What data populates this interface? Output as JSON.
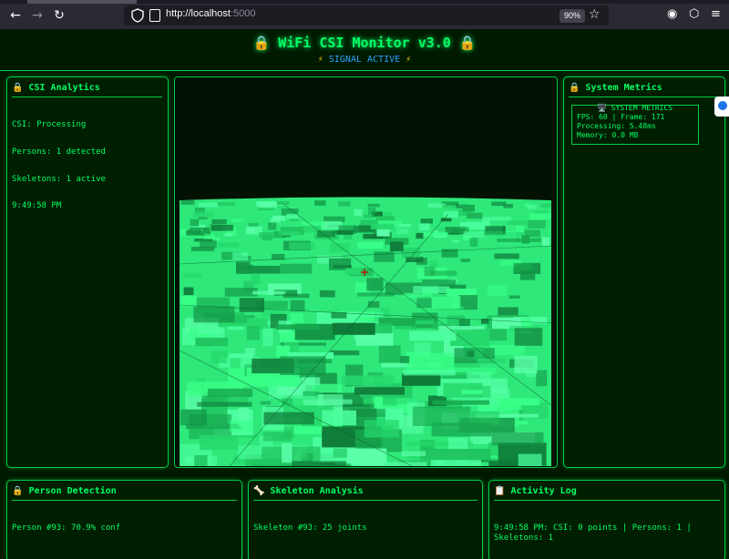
{
  "browser": {
    "url_host": "http://localhost",
    "url_port": ":5000",
    "zoom": "90%"
  },
  "app": {
    "title": "🔒 WiFi CSI Monitor v3.0 🔒",
    "status_left_icon": "⚡",
    "status": "SIGNAL ACTIVE",
    "status_right_icon": "⚡"
  },
  "csi_panel": {
    "title": "🔒 CSI Analytics",
    "csi": "CSI: Processing",
    "persons": "Persons: 1 detected",
    "skeletons": "Skeletons: 1 active",
    "time": "9:49:58 PM"
  },
  "system_panel": {
    "title": "🔒 System Metrics",
    "box_title": "🖥️ SYSTEM METRICS",
    "fps_frame": "FPS: 60 | Frame: 171",
    "processing": "Processing: 5.48ms",
    "memory": "Memory: 0.0 MB"
  },
  "person_panel": {
    "title": "🔒 Person Detection",
    "line": "Person #93: 70.9% conf"
  },
  "skeleton_panel": {
    "title": "🦴 Skeleton Analysis",
    "line": "Skeleton #93: 25 joints"
  },
  "activity_panel": {
    "title": "📋 Activity Log",
    "line1": "9:49:58 PM: CSI: 0 points | Persons: 1 |",
    "line2": "Skeletons: 1"
  },
  "colors": {
    "accent": "#00ff66",
    "border": "#00cc44",
    "background": "#001a00",
    "status_blue": "#2aa3ff"
  }
}
